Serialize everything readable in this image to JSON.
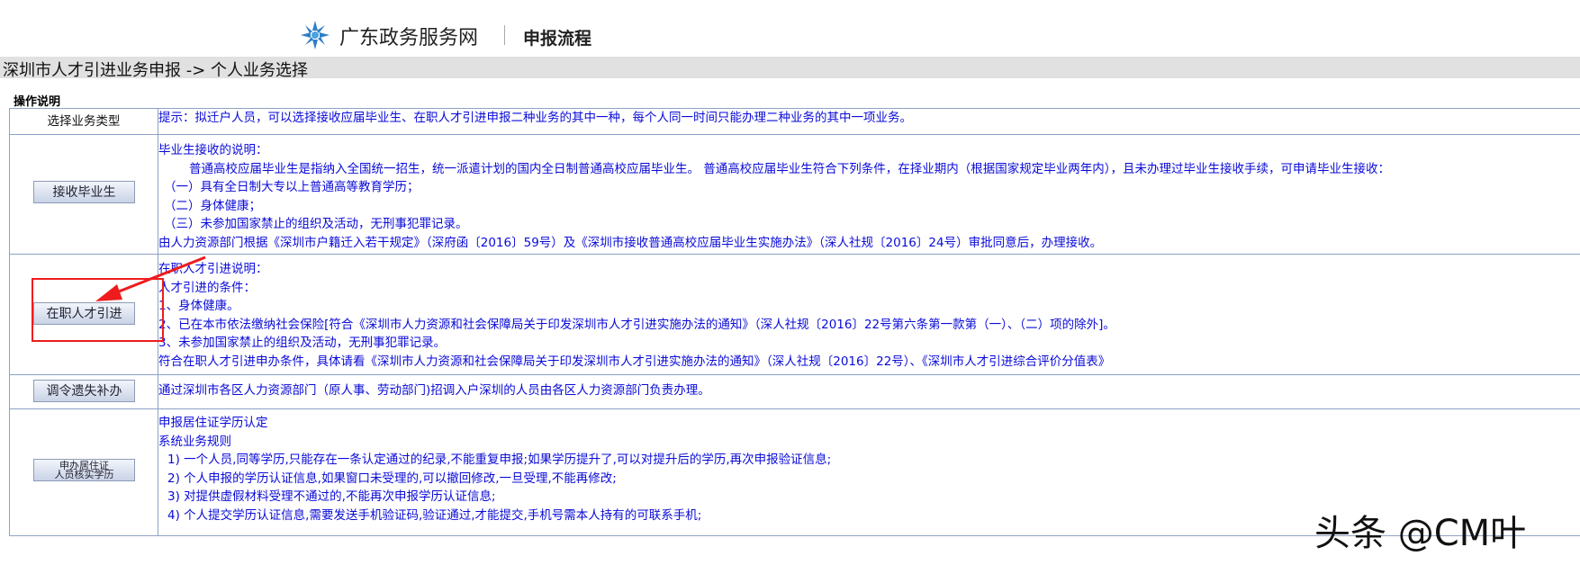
{
  "header": {
    "site_name": "广东政务服务网",
    "page_label": "申报流程",
    "logo_icon": "guangdong-gov-logo-icon"
  },
  "breadcrumb": "深圳市人才引进业务申报 -> 个人业务选择",
  "operations": {
    "title": "操作说明",
    "header_left": "选择业务类型",
    "header_right": "提示：拟迁户人员，可以选择接收应届毕业生、在职人才引进申报二种业务的其中一种，每个人同一时间只能办理二种业务的其中一项业务。",
    "graduate": {
      "button": "接收毕业生",
      "lines": [
        "毕业生接收的说明：",
        "普通高校应届毕业生是指纳入全国统一招生，统一派遣计划的国内全日制普通高校应届毕业生。 普通高校应届毕业生符合下列条件，在择业期内（根据国家规定毕业两年内），且未办理过毕业生接收手续，可申请毕业生接收：",
        "（一）具有全日制大专以上普通高等教育学历；",
        "（二）身体健康；",
        "（三）未参加国家禁止的组织及活动，无刑事犯罪记录。",
        "由人力资源部门根据《深圳市户籍迁入若干规定》（深府函〔2016〕59号）及《深圳市接收普通高校应届毕业生实施办法》（深人社规〔2016〕24号）审批同意后，办理接收。"
      ]
    },
    "talent": {
      "button": "在职人才引进",
      "lines": [
        "在职人才引进说明：",
        "人才引进的条件：",
        "1、身体健康。",
        "2、已在本市依法缴纳社会保险[符合《深圳市人力资源和社会保障局关于印发深圳市人才引进实施办法的通知》（深人社规〔2016〕22号第六条第一款第（一）、（二）项的除外]。",
        "3、未参加国家禁止的组织及活动，无刑事犯罪记录。",
        "符合在职人才引进申办条件，具体请看《深圳市人力资源和社会保障局关于印发深圳市人才引进实施办法的通知》（深人社规〔2016〕22号）、《深圳市人才引进综合评价分值表》"
      ]
    },
    "transfer": {
      "button": "调令遗失补办",
      "lines": [
        "通过深圳市各区人力资源部门（原人事、劳动部门)招调入户深圳的人员由各区人力资源部门负责办理。"
      ]
    },
    "education": {
      "button_line1": "申办居住证",
      "button_line2": "人员核实学历",
      "lines": [
        "申报居住证学历认定",
        "系统业务规则",
        "1) 一个人员,同等学历,只能存在一条认定通过的纪录,不能重复申报;如果学历提升了,可以对提升后的学历,再次申报验证信息;",
        "2) 个人申报的学历认证信息,如果窗口未受理的,可以撤回修改,一旦受理,不能再修改;",
        "3) 对提供虚假材料受理不通过的,不能再次申报学历认证信息;",
        "4) 个人提交学历认证信息,需要发送手机验证码,验证通过,才能提交,手机号需本人持有的可联系手机;"
      ]
    }
  },
  "annotation": {
    "highlight_color": "#ee1c1c",
    "arrow_icon": "red-arrow-icon"
  },
  "watermark": "头条 @CM叶",
  "colors": {
    "text_blue": "#0a0ad8",
    "border": "#8ea2c4",
    "crumb_bg": "#e1e1e1"
  }
}
